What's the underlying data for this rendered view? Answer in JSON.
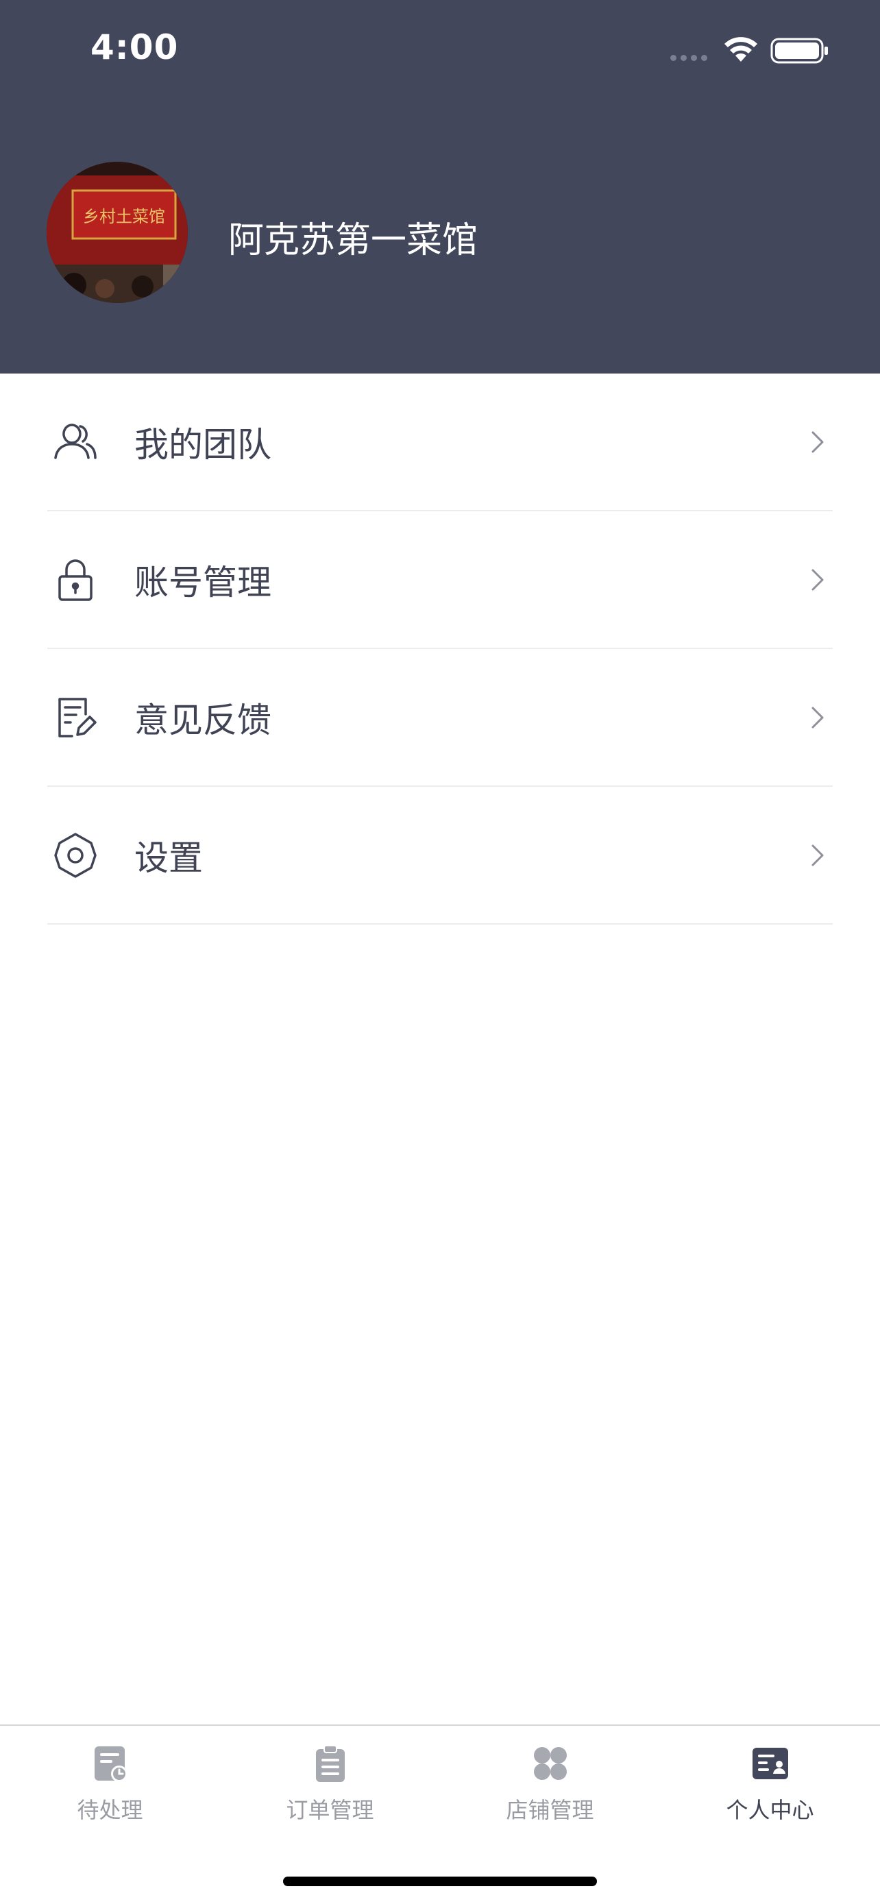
{
  "status_bar": {
    "time": "4:00"
  },
  "profile": {
    "shop_name": "阿克苏第一菜馆",
    "avatar_sign_text": "乡村土菜馆"
  },
  "menu": {
    "items": [
      {
        "label": "我的团队",
        "icon": "team-icon"
      },
      {
        "label": "账号管理",
        "icon": "lock-icon"
      },
      {
        "label": "意见反馈",
        "icon": "feedback-icon"
      },
      {
        "label": "设置",
        "icon": "gear-icon"
      }
    ]
  },
  "tabbar": {
    "tabs": [
      {
        "label": "待处理",
        "icon": "pending-icon",
        "active": false
      },
      {
        "label": "订单管理",
        "icon": "orders-icon",
        "active": false
      },
      {
        "label": "店铺管理",
        "icon": "store-icon",
        "active": false
      },
      {
        "label": "个人中心",
        "icon": "profile-card-icon",
        "active": true
      }
    ]
  },
  "colors": {
    "header_bg": "#43475c",
    "text_primary": "#3f4354",
    "text_inactive": "#9a9ca4",
    "divider": "#ececee"
  }
}
